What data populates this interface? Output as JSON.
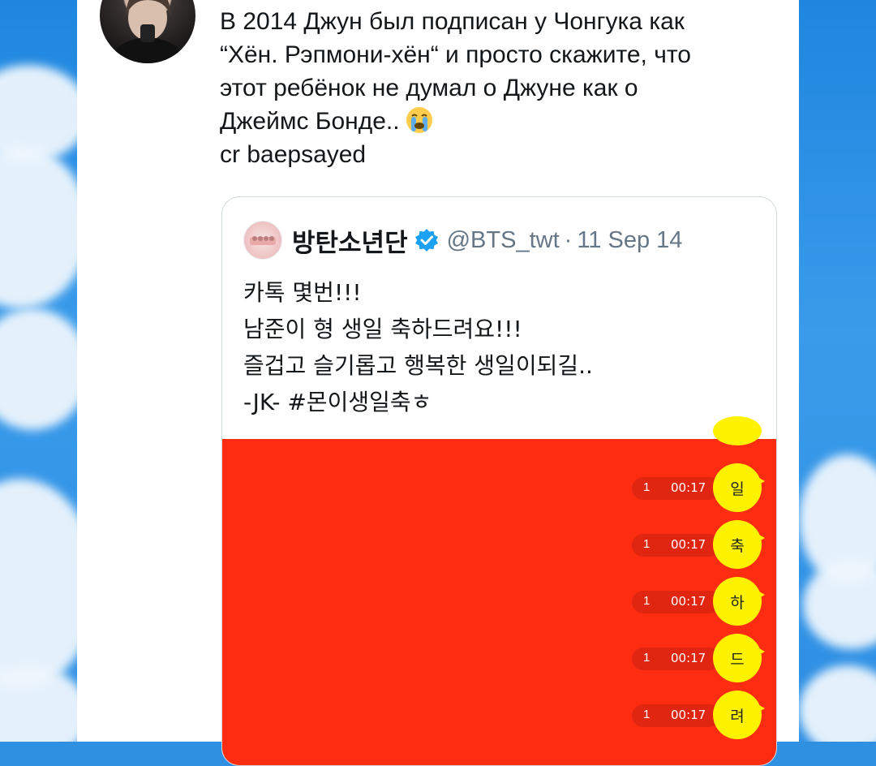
{
  "tweet": {
    "lines": [
      "В 2014 Джун был подписан у Чонгука как",
      "“Хён. Рэпмони-хён“ и просто скажите, что",
      "этот ребёнок не думал о Джуне как о",
      "Джеймс Бонде..",
      "cr baepsayed"
    ],
    "emoji": "loudly-crying-face-emoji"
  },
  "quoted": {
    "name": "방탄소년단",
    "handle": "@BTS_twt",
    "separator": "·",
    "date": "11 Sep 14",
    "lines": [
      "카톡 몇번!!!",
      "남준이 형 생일 축하드려요!!!",
      "즐겁고 슬기롭고 행복한 생일이되길..",
      "-JK- #몬이생일축ㅎ"
    ],
    "media": {
      "background": "#fe2d12",
      "bubble_color": "#fff200",
      "messages": [
        {
          "count": "1",
          "time": "00:17",
          "text": "일"
        },
        {
          "count": "1",
          "time": "00:17",
          "text": "축"
        },
        {
          "count": "1",
          "time": "00:17",
          "text": "하"
        },
        {
          "count": "1",
          "time": "00:17",
          "text": "드"
        },
        {
          "count": "1",
          "time": "00:17",
          "text": "려"
        }
      ]
    }
  },
  "colors": {
    "sky": "#2f8fe0",
    "verified": "#1da1f2",
    "text": "#14171a",
    "muted": "#657786"
  }
}
